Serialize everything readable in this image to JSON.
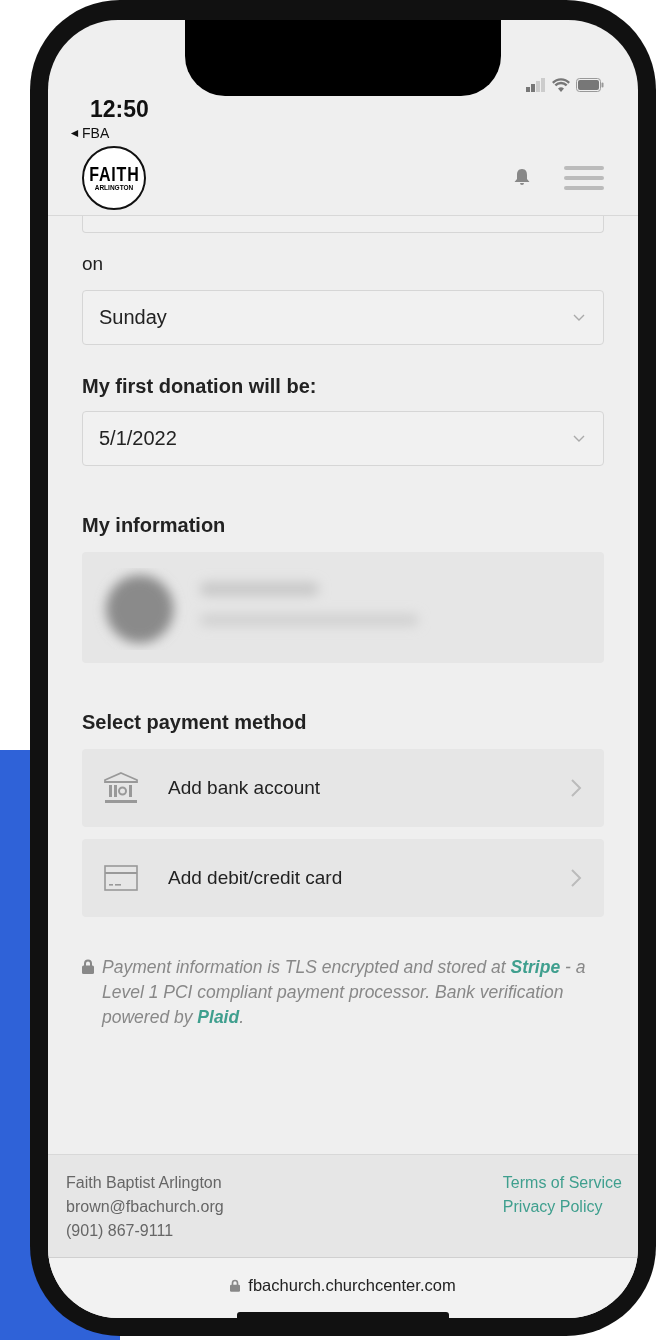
{
  "status_bar": {
    "time": "12:50",
    "back_app": "FBA"
  },
  "header": {
    "logo": {
      "line_1": "FAITH",
      "line_2": "ARLINGTON"
    }
  },
  "schedule": [
    {
      "label": "on",
      "value": "Sunday"
    },
    {
      "label": "My first donation will be:",
      "value": "5/1/2022"
    }
  ],
  "my_information": {
    "heading": "My information"
  },
  "payment": {
    "heading": "Select payment method",
    "methods": [
      {
        "kind": "bank",
        "label": "Add bank account"
      },
      {
        "kind": "card",
        "label": "Add debit/credit card"
      }
    ]
  },
  "security_note": [
    {
      "kind": "text",
      "text": "Payment information is TLS encrypted and stored at "
    },
    {
      "kind": "link",
      "text": "Stripe"
    },
    {
      "kind": "text",
      "text": " - a Level 1 PCI compliant payment processor. Bank verification powered by "
    },
    {
      "kind": "link",
      "text": "Plaid"
    },
    {
      "kind": "text",
      "text": "."
    }
  ],
  "footer": {
    "org": "Faith Baptist Arlington",
    "email": "brown@fbachurch.org",
    "phone": "(901) 867-9111",
    "links": [
      "Terms of Service",
      "Privacy Policy"
    ]
  },
  "url_bar": {
    "url": "fbachurch.churchcenter.com"
  }
}
